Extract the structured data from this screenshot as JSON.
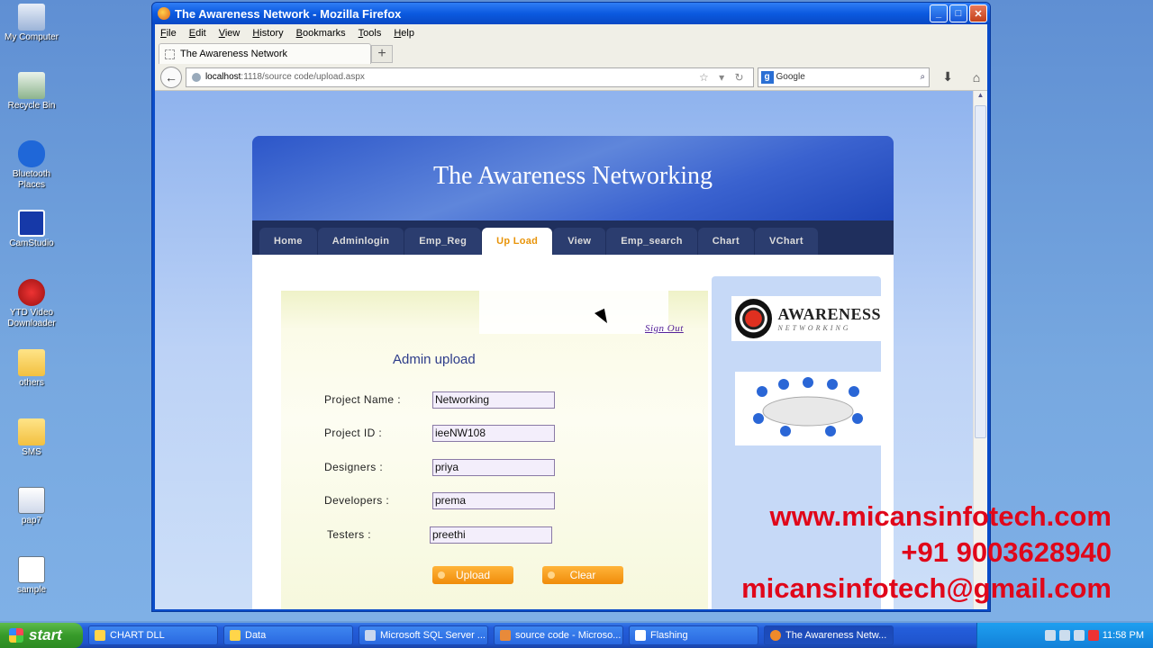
{
  "desktop": {
    "icons": [
      {
        "label": "My Computer"
      },
      {
        "label": "Recycle Bin"
      },
      {
        "label": "Bluetooth Places"
      },
      {
        "label": "CamStudio"
      },
      {
        "label": "YTD Video Downloader"
      },
      {
        "label": "others"
      },
      {
        "label": "SMS"
      },
      {
        "label": "pap7"
      },
      {
        "label": "sample"
      }
    ]
  },
  "window": {
    "title": "The Awareness Network - Mozilla Firefox",
    "controls": {
      "minimize": "_",
      "maximize": "□",
      "close": "✕"
    }
  },
  "menu": [
    "File",
    "Edit",
    "View",
    "History",
    "Bookmarks",
    "Tools",
    "Help"
  ],
  "tab": {
    "title": "The Awareness Network",
    "new_tab": "+"
  },
  "nav": {
    "back": "←",
    "url_host": "localhost",
    "url_path": ":1118/source code/upload.aspx",
    "url_tools": "☆ ▾ ↻",
    "search_engine": "g",
    "search_placeholder": "Google",
    "search_btn": "⌕",
    "download": "⬇",
    "home": "⌂"
  },
  "site": {
    "banner_title": "The Awareness Networking",
    "nav_tabs": [
      {
        "label": "Home"
      },
      {
        "label": "Adminlogin"
      },
      {
        "label": "Emp_Reg"
      },
      {
        "label": "Up Load"
      },
      {
        "label": "View"
      },
      {
        "label": "Emp_search"
      },
      {
        "label": "Chart"
      },
      {
        "label": "VChart"
      }
    ],
    "active_tab": "Up Load",
    "sign_out": "Sign Out",
    "form_title": "Admin upload",
    "fields": [
      {
        "label": "Project Name :",
        "value": "Networking"
      },
      {
        "label": "Project ID :",
        "value": "ieeNW108"
      },
      {
        "label": "Designers :",
        "value": "priya"
      },
      {
        "label": "Developers :",
        "value": "prema"
      },
      {
        "label": "Testers :",
        "value": "preethi"
      }
    ],
    "buttons": {
      "upload": "Upload",
      "clear": "Clear"
    },
    "logo": {
      "name": "AWARENESS",
      "tagline": "NETWORKING"
    }
  },
  "watermark": {
    "line1": "www.micansinfotech.com",
    "line2": "+91 9003628940",
    "line3": "micansinfotech@gmail.com"
  },
  "taskbar": {
    "start": "start",
    "tasks": [
      {
        "label": "CHART DLL"
      },
      {
        "label": "Data"
      },
      {
        "label": "Microsoft SQL Server ..."
      },
      {
        "label": "source code - Microso..."
      },
      {
        "label": "Flashing"
      },
      {
        "label": "The Awareness Netw..."
      }
    ],
    "clock": "11:58 PM",
    "colors": {
      "accent": "#245edb",
      "start": "#379a2a"
    }
  }
}
